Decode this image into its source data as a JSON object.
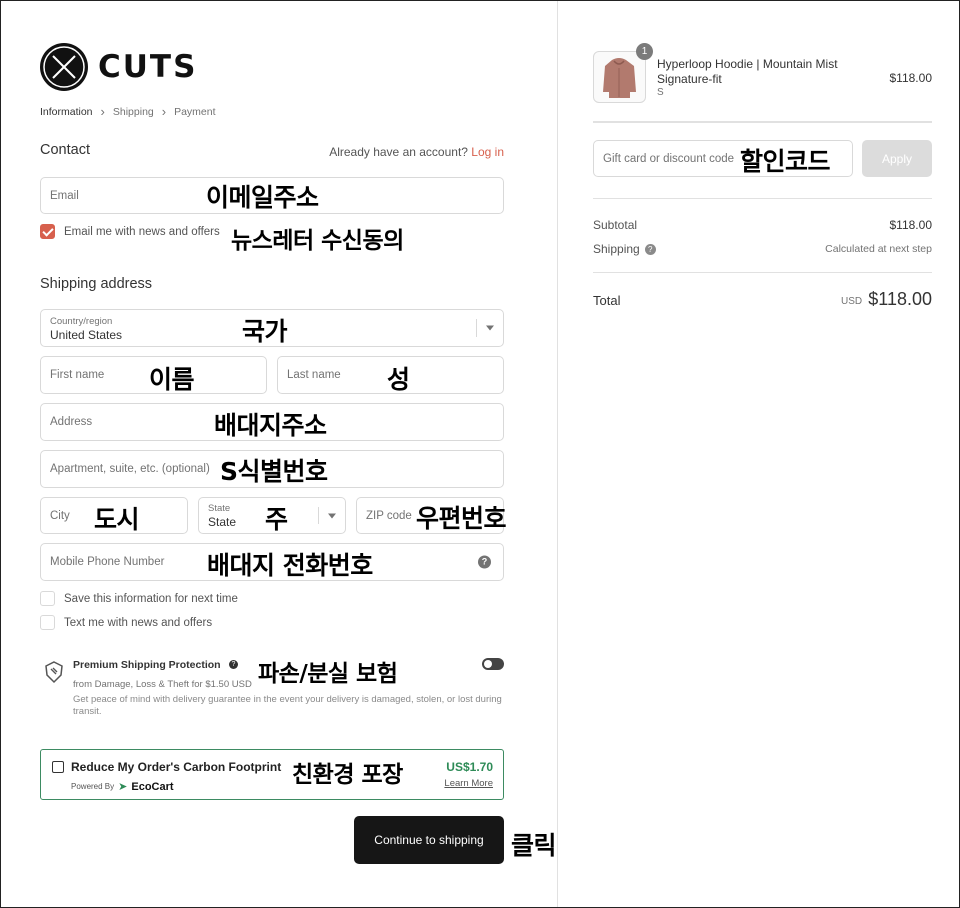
{
  "brand": {
    "name": "CUTS"
  },
  "breadcrumb": [
    "Information",
    "Shipping",
    "Payment"
  ],
  "contact": {
    "title": "Contact",
    "account_prompt": "Already have an account?",
    "login_label": "Log in",
    "email_placeholder": "Email",
    "newsletter_label": "Email me with news and offers"
  },
  "shipping": {
    "title": "Shipping address",
    "country_label": "Country/region",
    "country_value": "United States",
    "first_name_placeholder": "First name",
    "last_name_placeholder": "Last name",
    "address_placeholder": "Address",
    "apartment_placeholder": "Apartment, suite, etc. (optional)",
    "city_placeholder": "City",
    "state_label": "State",
    "state_value": "State",
    "zip_placeholder": "ZIP code",
    "phone_placeholder": "Mobile Phone Number",
    "save_info_label": "Save this information for next time",
    "sms_label": "Text me with news and offers"
  },
  "protection": {
    "title": "Premium Shipping Protection",
    "subtitle": "from Damage, Loss & Theft for $1.50 USD",
    "description": "Get peace of mind with delivery guarantee in the event your delivery is damaged, stolen, or lost during transit."
  },
  "ecocart": {
    "title": "Reduce My Order's Carbon Footprint",
    "powered_by": "Powered By",
    "brand": "EcoCart",
    "price": "US$1.70",
    "learn_more": "Learn More"
  },
  "cta": {
    "label": "Continue to shipping"
  },
  "order": {
    "item": {
      "quantity": "1",
      "name": "Hyperloop Hoodie | Mountain Mist Signature-fit",
      "variant": "S",
      "price": "$118.00"
    },
    "discount_placeholder": "Gift card or discount code",
    "apply_label": "Apply",
    "subtotal_label": "Subtotal",
    "subtotal_value": "$118.00",
    "shipping_label": "Shipping",
    "shipping_value": "Calculated at next step",
    "total_label": "Total",
    "total_currency": "USD",
    "total_value": "$118.00"
  },
  "annotations": {
    "email": "이메일주소",
    "newsletter": "뉴스레터 수신동의",
    "country": "국가",
    "first_name": "이름",
    "last_name": "성",
    "address": "배대지주소",
    "apartment": "S식별번호",
    "city": "도시",
    "state": "주",
    "zip": "우편번호",
    "phone": "배대지 전화번호",
    "protection": "파손/분실 보험",
    "eco": "친환경 포장",
    "click": "클릭",
    "discount": "할인코드"
  },
  "colors": {
    "accent": "#d7604d",
    "eco_green": "#2e8b57",
    "button_dark": "#161616"
  }
}
